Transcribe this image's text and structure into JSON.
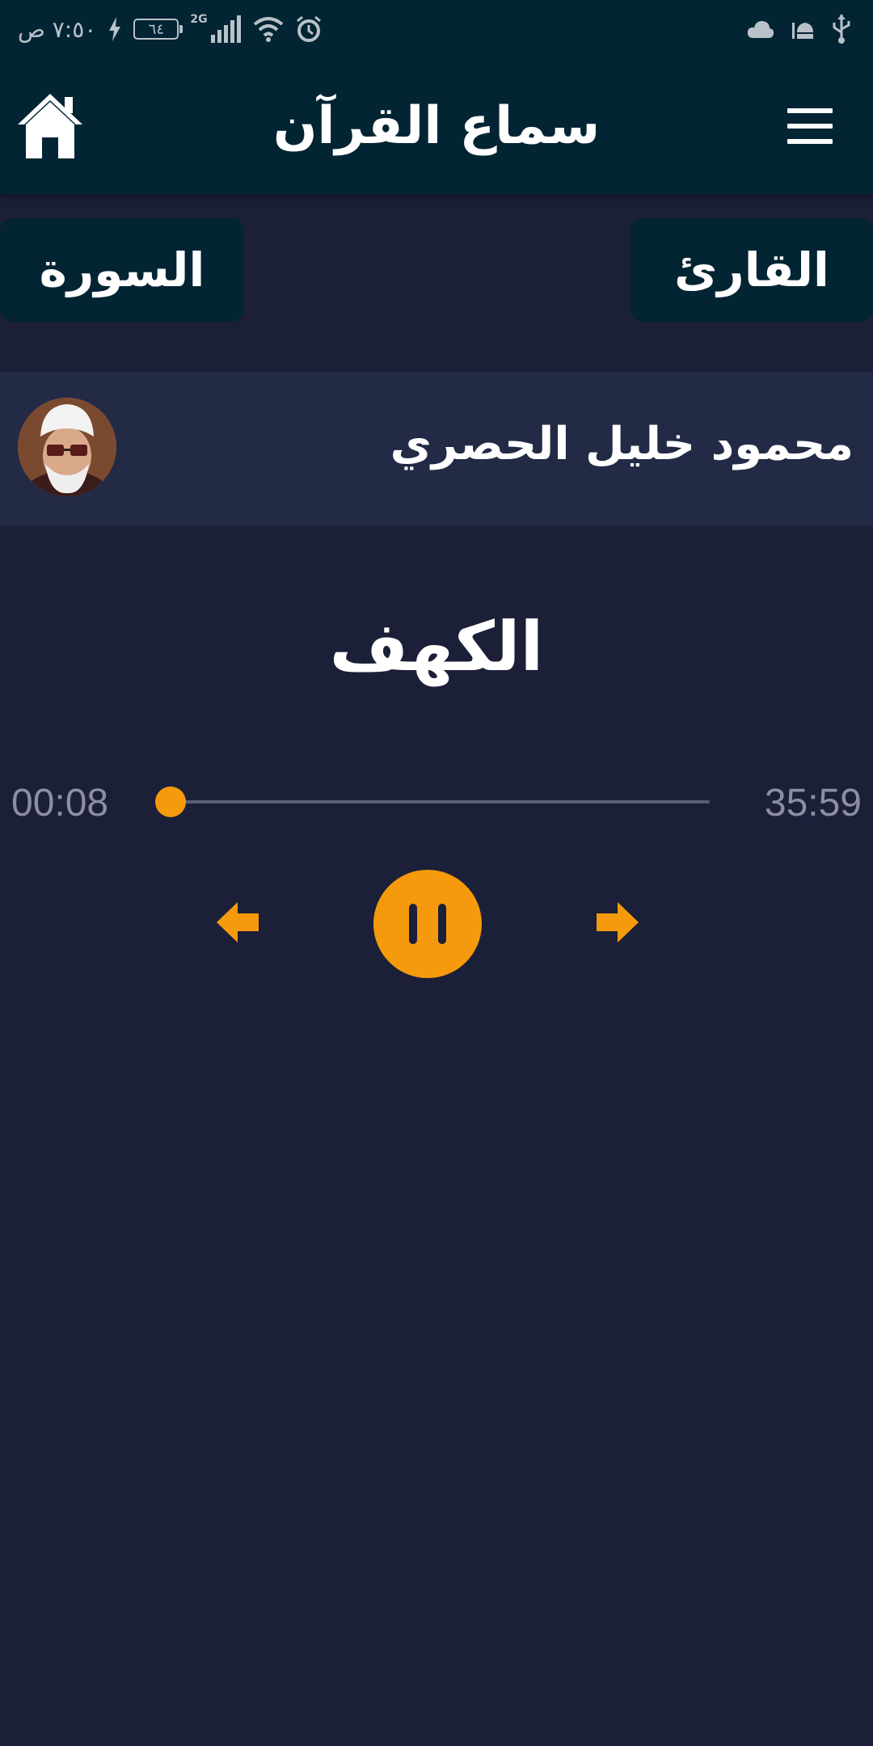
{
  "status_bar": {
    "time": "٧:٥٠ ص",
    "battery_level": "٦٤",
    "network_type": "2G",
    "icons": [
      "charging-icon",
      "battery-icon",
      "signal-icon",
      "wifi-icon",
      "alarm-icon",
      "cloud-icon",
      "mosque-icon",
      "usb-icon"
    ]
  },
  "header": {
    "title": "سماع القرآن",
    "home_icon": "home-icon",
    "menu_icon": "menu-icon"
  },
  "selectors": {
    "surah_label": "السورة",
    "reciter_label": "القارئ"
  },
  "reciter": {
    "name": "محمود خليل الحصري"
  },
  "player": {
    "surah_name": "الكهف",
    "elapsed": "00:08",
    "total": "35:59",
    "progress_fraction": 0.004,
    "accent_color": "#f59a0c"
  },
  "colors": {
    "background": "#1c1f38",
    "header": "#022433",
    "reciter_row": "#222a46",
    "accent": "#f59a0c"
  }
}
